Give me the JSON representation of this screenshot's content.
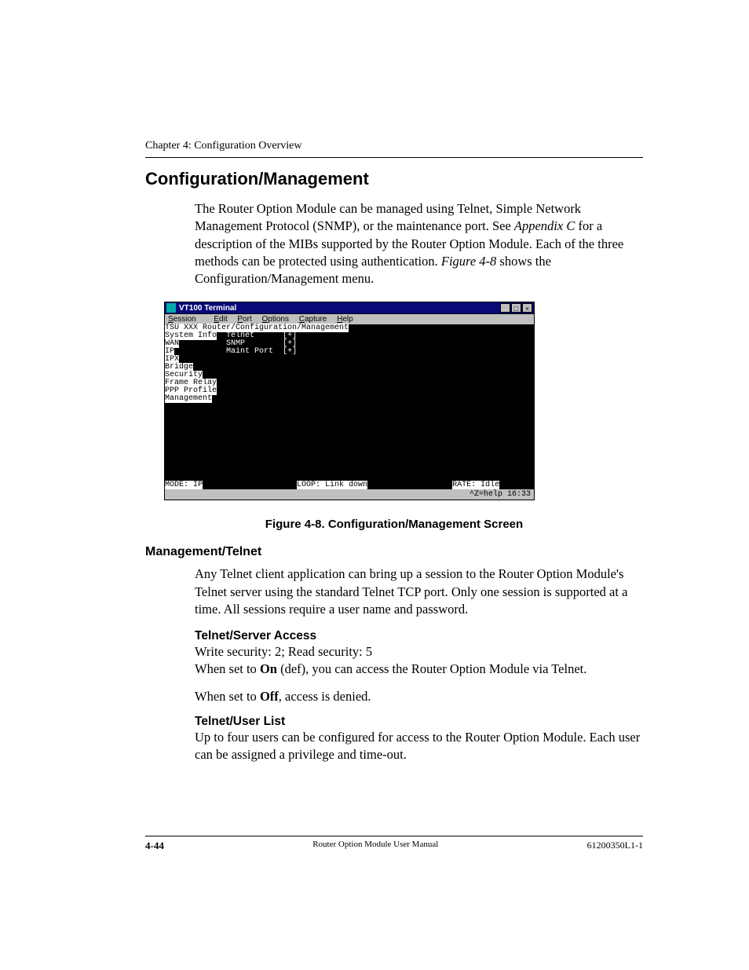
{
  "chapter": "Chapter 4:  Configuration Overview",
  "h1": "Configuration/Management",
  "intro": {
    "p1a": "The Router Option Module can be managed using Telnet, Simple Network Management Protocol (SNMP), or the maintenance port. See ",
    "p1b_italic": "Appendix C",
    "p1c": " for a description of the MIBs supported by the Router Option Module. Each of the three methods can be protected using authentication. ",
    "p1d_italic": "Figure 4-8",
    "p1e": " shows the Configuration/Management menu."
  },
  "terminal": {
    "title": "VT100 Terminal",
    "menubar": [
      "Session",
      "Edit",
      "Port",
      "Options",
      "Capture",
      "Help"
    ],
    "path": "TSU XXX Router/Configuration/Management",
    "left_menu": [
      "System Info",
      "WAN",
      "IP",
      "IPX",
      "Bridge",
      "Security",
      "Frame Relay",
      "PPP Profile",
      "Management"
    ],
    "right_menu": [
      {
        "label": "Telnet",
        "val": "[+]"
      },
      {
        "label": "SNMP",
        "val": "[+]"
      },
      {
        "label": "Maint Port",
        "val": "[+]"
      }
    ],
    "status_left": "MODE: IP",
    "status_mid": "LOOP: Link down",
    "status_right": "RATE: Idle",
    "statusbar": "^Z=help 16:33"
  },
  "fig_caption": "Figure 4-8.  Configuration/Management Screen",
  "h2_mgmt_telnet": "Management/Telnet",
  "p_mgmt_telnet": "Any Telnet client application can bring up a session to the Router Option Module's Telnet server using the standard Telnet TCP port. Only one session is supported at a time.  All sessions require a user name and password.",
  "h3_server_access": "Telnet/Server Access",
  "p_sa_1": "Write security: 2; Read security: 5",
  "p_sa_2a": "When set to ",
  "p_sa_2b_bold": "On",
  "p_sa_2c": " (def), you can access the Router Option Module via Telnet.",
  "p_sa_3a": "When set to ",
  "p_sa_3b_bold": "Off",
  "p_sa_3c": ", access is denied.",
  "h3_user_list": "Telnet/User List",
  "p_user_list": "Up to four users can be configured for access to the Router Option Module.  Each user can be assigned a privilege and time-out.",
  "footer": {
    "page": "4-44",
    "mid": "Router Option Module User Manual",
    "right": "61200350L1-1"
  }
}
